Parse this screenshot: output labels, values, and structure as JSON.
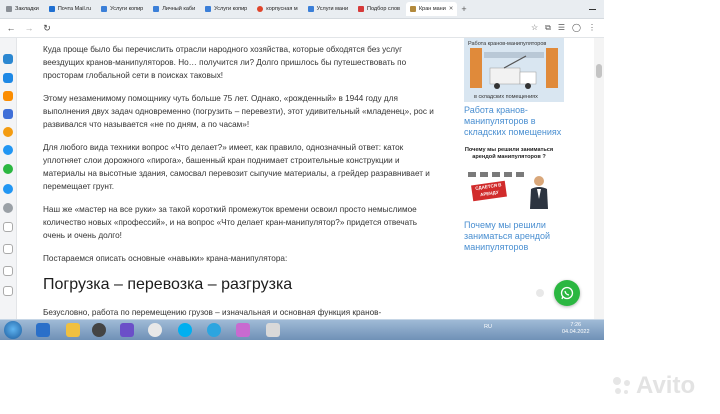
{
  "browser": {
    "tabs": [
      {
        "label": "Закладки",
        "color": "#8a8f96",
        "active": false
      },
      {
        "label": "Почта Mail.ru",
        "color": "#1f6fd1",
        "active": false
      },
      {
        "label": "Услуги копир",
        "color": "#3b7fd8",
        "active": false
      },
      {
        "label": "Личный каби",
        "color": "#3b7fd8",
        "active": false
      },
      {
        "label": "Услуги копир",
        "color": "#3b7fd8",
        "active": false
      },
      {
        "label": "корпусная м",
        "color": "#e0442b",
        "active": false
      },
      {
        "label": "Услуги мани",
        "color": "#3b7fd8",
        "active": false
      },
      {
        "label": "Подбор слов",
        "color": "#d63a3a",
        "active": false
      },
      {
        "label": "Кран мани",
        "color": "#b38a3c",
        "active": true
      }
    ],
    "new_tab": "+"
  },
  "article": {
    "paragraphs_top": [
      "Куда проще было бы перечислить отрасли народного хозяйства, которые обходятся без услуг веездущих кранов-манипуляторов. Но… получится ли? Долго пришлось бы путешествовать по просторам глобальной сети в поисках таковых!",
      "Этому незаменимому помощнику чуть больше 75 лет. Однако, «рожденный» в 1944 году для выполнения двух задач одновременно (погрузить – перевезти), этот удивительный «младенец», рос и развивался что называется «не по дням, а по часам»!",
      "Для любого вида техники вопрос «Что делает?» имеет, как правило, однозначный ответ: каток уплотняет слои дорожного «пирога», башенный кран поднимает строительные конструкции и материалы на высотные здания, самосвал перевозит сыпучие материалы, а грейдер разравнивает и перемещает грунт.",
      "Наш же «мастер на все руки» за такой короткий промежуток времени освоил просто немыслимое количество новых «профессий», и на вопрос «Что делает кран-манипулятор?» придется отвечать очень и очень долго!",
      "Постараемся описать основные «навыки» крана-манипулятора:"
    ],
    "heading": "Погрузка – перевозка – разгрузка",
    "paragraph_bottom": "Безусловно, работа по перемещению грузов – изначальная и основная функция кранов-манипуляторов. Но ведь грузы – они такие разные! Многофункционального"
  },
  "sidebar_right": {
    "card1_title": "Работа кранов-манипуляторов",
    "card1_caption": "в складских помещениях",
    "link1": "Работа кранов-манипуляторов в складских помещениях",
    "card2_title": "Почему мы решили заниматься арендой манипуляторов ?",
    "card2_stamp": "СДАЕТСЯ В АРЕНДУ",
    "link2": "Почему мы решили заниматься арендой манипуляторов"
  },
  "taskbar": {
    "lang": "RU",
    "time": "7:26",
    "date": "04.04.2022"
  },
  "watermark": "Avito",
  "colors": {
    "link": "#4a8fd1",
    "whatsapp": "#2bb741",
    "taskbar": "#7f9fc2"
  }
}
